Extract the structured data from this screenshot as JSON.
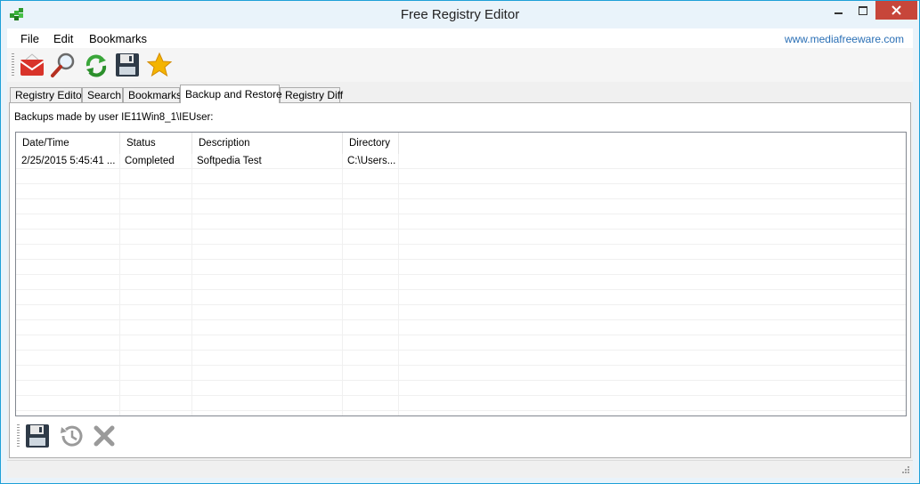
{
  "window": {
    "title": "Free Registry Editor"
  },
  "menu": {
    "items": [
      "File",
      "Edit",
      "Bookmarks"
    ]
  },
  "site_link": "www.mediafreeware.com",
  "toolbar": {
    "icons": [
      "email-icon",
      "search-icon",
      "refresh-icon",
      "save-icon",
      "bookmark-star-icon"
    ]
  },
  "tabs": [
    {
      "label": "Registry Editor"
    },
    {
      "label": "Search"
    },
    {
      "label": "Bookmarks"
    },
    {
      "label": "Backup and Restore",
      "active": true
    },
    {
      "label": "Registry Diff"
    }
  ],
  "backup": {
    "caption": "Backups made by user IE11Win8_1\\IEUser:",
    "columns": [
      "Date/Time",
      "Status",
      "Description",
      "Directory"
    ],
    "rows": [
      {
        "datetime": "2/25/2015 5:45:41 ...",
        "status": "Completed",
        "description": "Softpedia Test",
        "directory": "C:\\Users..."
      }
    ]
  },
  "bottom_toolbar": {
    "icons": [
      "save-backup-icon",
      "restore-history-icon",
      "delete-x-icon"
    ]
  },
  "colors": {
    "accent": "#1ea0d8",
    "close": "#c7463a",
    "link": "#2a6fb5"
  }
}
